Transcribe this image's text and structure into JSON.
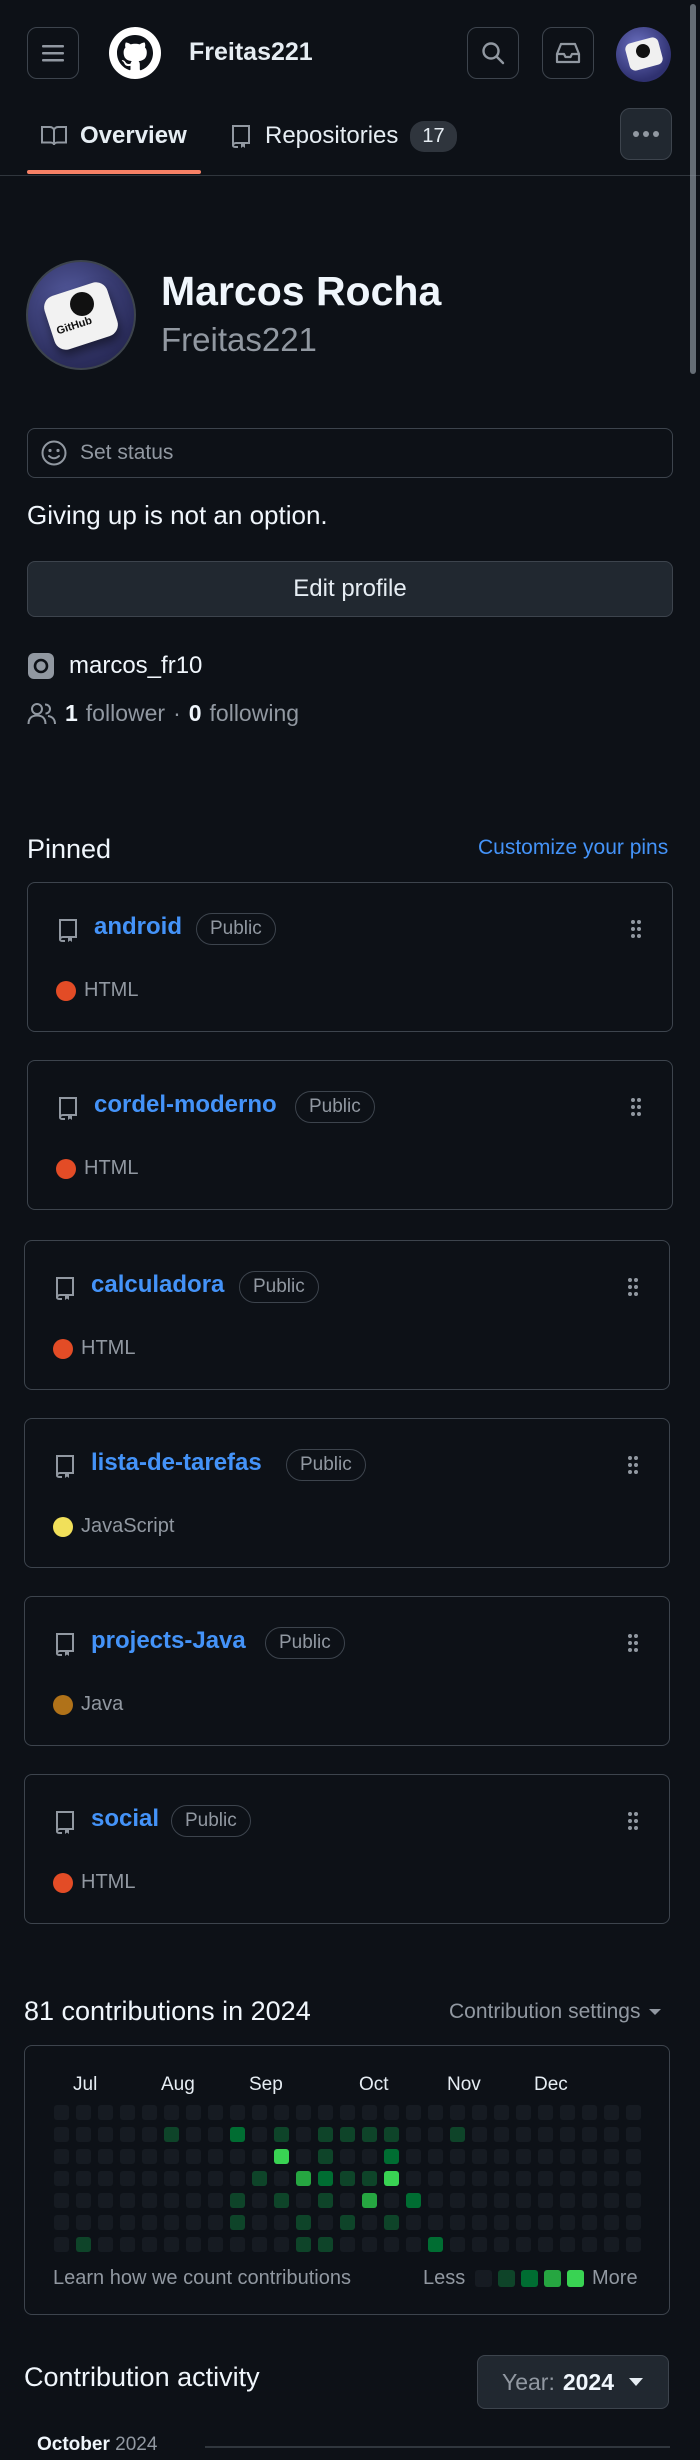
{
  "header": {
    "username": "Freitas221"
  },
  "tabs": [
    {
      "label": "Overview"
    },
    {
      "label": "Repositories",
      "count": "17"
    }
  ],
  "profile": {
    "name": "Marcos Rocha",
    "login": "Freitas221",
    "status_label": "Set status",
    "bio": "Giving up is not an option.",
    "edit_label": "Edit profile",
    "social_handle": "marcos_fr10",
    "followers_count": "1",
    "followers_label": "follower",
    "separator": "·",
    "following_count": "0",
    "following_label": "following",
    "avatar_text": "GitHub"
  },
  "pinned": {
    "title": "Pinned",
    "customize_label": "Customize your pins",
    "repos": [
      {
        "name": "android",
        "visibility": "Public",
        "language": "HTML",
        "color": "#e34c26"
      },
      {
        "name": "cordel-moderno",
        "visibility": "Public",
        "language": "HTML",
        "color": "#e34c26"
      },
      {
        "name": "calculadora",
        "visibility": "Public",
        "language": "HTML",
        "color": "#e34c26"
      },
      {
        "name": "lista-de-tarefas",
        "visibility": "Public",
        "language": "JavaScript",
        "color": "#f1e05a"
      },
      {
        "name": "projects-Java",
        "visibility": "Public",
        "language": "Java",
        "color": "#b07219"
      },
      {
        "name": "social",
        "visibility": "Public",
        "language": "HTML",
        "color": "#e34c26"
      }
    ]
  },
  "contributions": {
    "title": "81 contributions in 2024",
    "settings_label": "Contribution settings",
    "months": [
      "Jul",
      "Aug",
      "Sep",
      "Oct",
      "Nov",
      "Dec"
    ],
    "learn_label": "Learn how we count contributions",
    "less_label": "Less",
    "more_label": "More",
    "colors": [
      "#161b22",
      "#0e4429",
      "#006d32",
      "#26a641",
      "#39d353"
    ]
  },
  "activity": {
    "title": "Contribution activity",
    "year_prefix": "Year:",
    "year_value": "2024",
    "month": "October",
    "month_year": "2024"
  }
}
